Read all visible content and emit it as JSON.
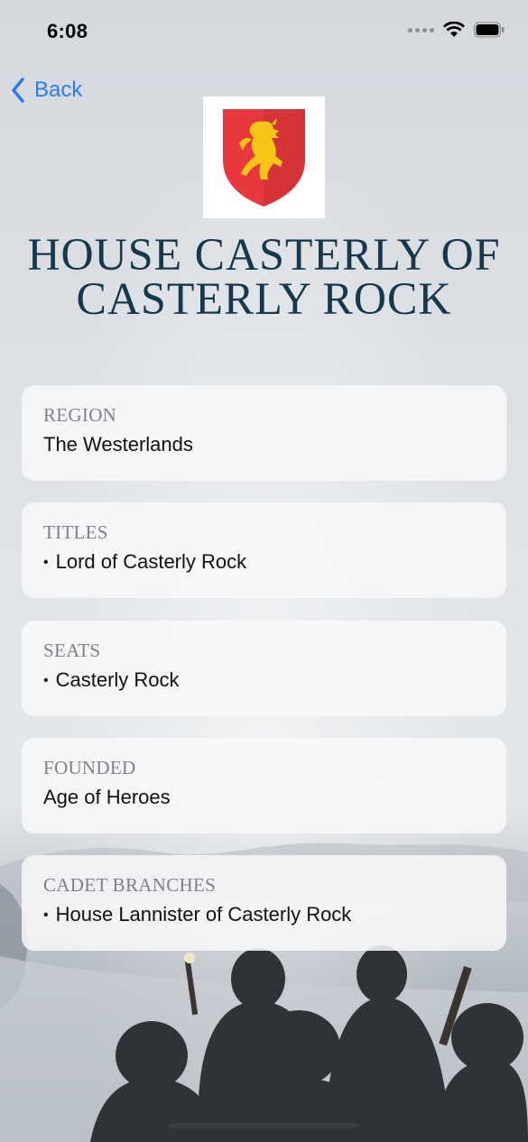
{
  "status_bar": {
    "time": "6:08"
  },
  "nav": {
    "back_label": "Back"
  },
  "house": {
    "name": "House Casterly of Casterly Rock",
    "crest_description": "lion-rampant-crest-icon",
    "crest_colors": {
      "shield": "#e8383d",
      "lion": "#f5c518"
    }
  },
  "details": [
    {
      "label": "Region",
      "value": "The Westerlands",
      "bullet": false
    },
    {
      "label": "Titles",
      "value": "Lord of Casterly Rock",
      "bullet": true
    },
    {
      "label": "Seats",
      "value": "Casterly Rock",
      "bullet": true
    },
    {
      "label": "Founded",
      "value": "Age of Heroes",
      "bullet": false
    },
    {
      "label": "Cadet Branches",
      "value": "House Lannister of Casterly Rock",
      "bullet": true
    }
  ],
  "colors": {
    "accent": "#2a7ce8",
    "title": "#16384d"
  }
}
